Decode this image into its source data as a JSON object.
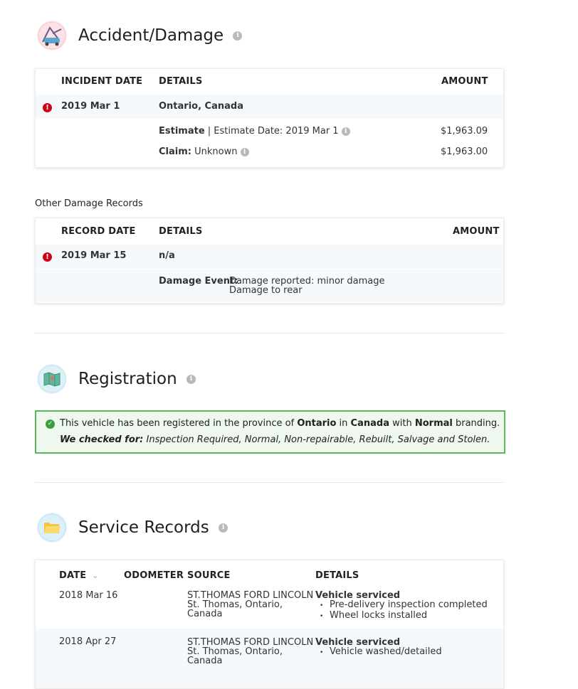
{
  "accident": {
    "title": "Accident/Damage",
    "headers": {
      "date": "INCIDENT DATE",
      "details": "DETAILS",
      "amount": "AMOUNT"
    },
    "row_date": "2019 Mar 1",
    "row_location": "Ontario, Canada",
    "estimate_label": "Estimate",
    "estimate_text": "| Estimate Date: 2019 Mar 1",
    "estimate_amount": "$1,963.09",
    "claim_label": "Claim:",
    "claim_text": "Unknown",
    "claim_amount": "$1,963.00"
  },
  "other_damage": {
    "heading": "Other Damage Records",
    "headers": {
      "date": "RECORD DATE",
      "details": "DETAILS",
      "amount": "AMOUNT"
    },
    "row_date": "2019 Mar 15",
    "row_details": "n/a",
    "event_label": "Damage Event:",
    "event_line1": "Damage reported: minor damage",
    "event_line2": "Damage to rear"
  },
  "registration": {
    "title": "Registration",
    "text_pre": "This vehicle has been registered in the province of",
    "province": "Ontario",
    "text_in": "in",
    "country": "Canada",
    "text_with": "with",
    "branding": "Normal",
    "text_end": "branding.",
    "checked_label": "We checked for:",
    "checked_list": "Inspection Required, Normal, Non-repairable, Rebuilt, Salvage and Stolen."
  },
  "service": {
    "title": "Service Records",
    "headers": {
      "date": "DATE",
      "sort_glyph": "⌄",
      "odometer": "ODOMETER",
      "source": "SOURCE",
      "details": "DETAILS"
    },
    "records": [
      {
        "date": "2018 Mar 16",
        "source_name": "ST.THOMAS FORD LINCOLN",
        "source_city": "St. Thomas, Ontario,",
        "source_country": "Canada",
        "title": "Vehicle serviced",
        "items": [
          "Pre-delivery inspection completed",
          "Wheel locks installed"
        ]
      },
      {
        "date": "2018 Apr 27",
        "source_name": "ST.THOMAS FORD LINCOLN",
        "source_city": "St. Thomas, Ontario,",
        "source_country": "Canada",
        "title": "Vehicle serviced",
        "items": [
          "Vehicle washed/detailed"
        ]
      }
    ]
  },
  "icons": {
    "info": "info-icon",
    "error": "error-icon",
    "check": "check-circle-icon",
    "accident": "car-accident-icon",
    "registration": "map-icon",
    "service": "folder-icon"
  },
  "colors": {
    "error": "#d0021b",
    "success": "#5cb85c",
    "row_alt": "#f6f9fc"
  }
}
